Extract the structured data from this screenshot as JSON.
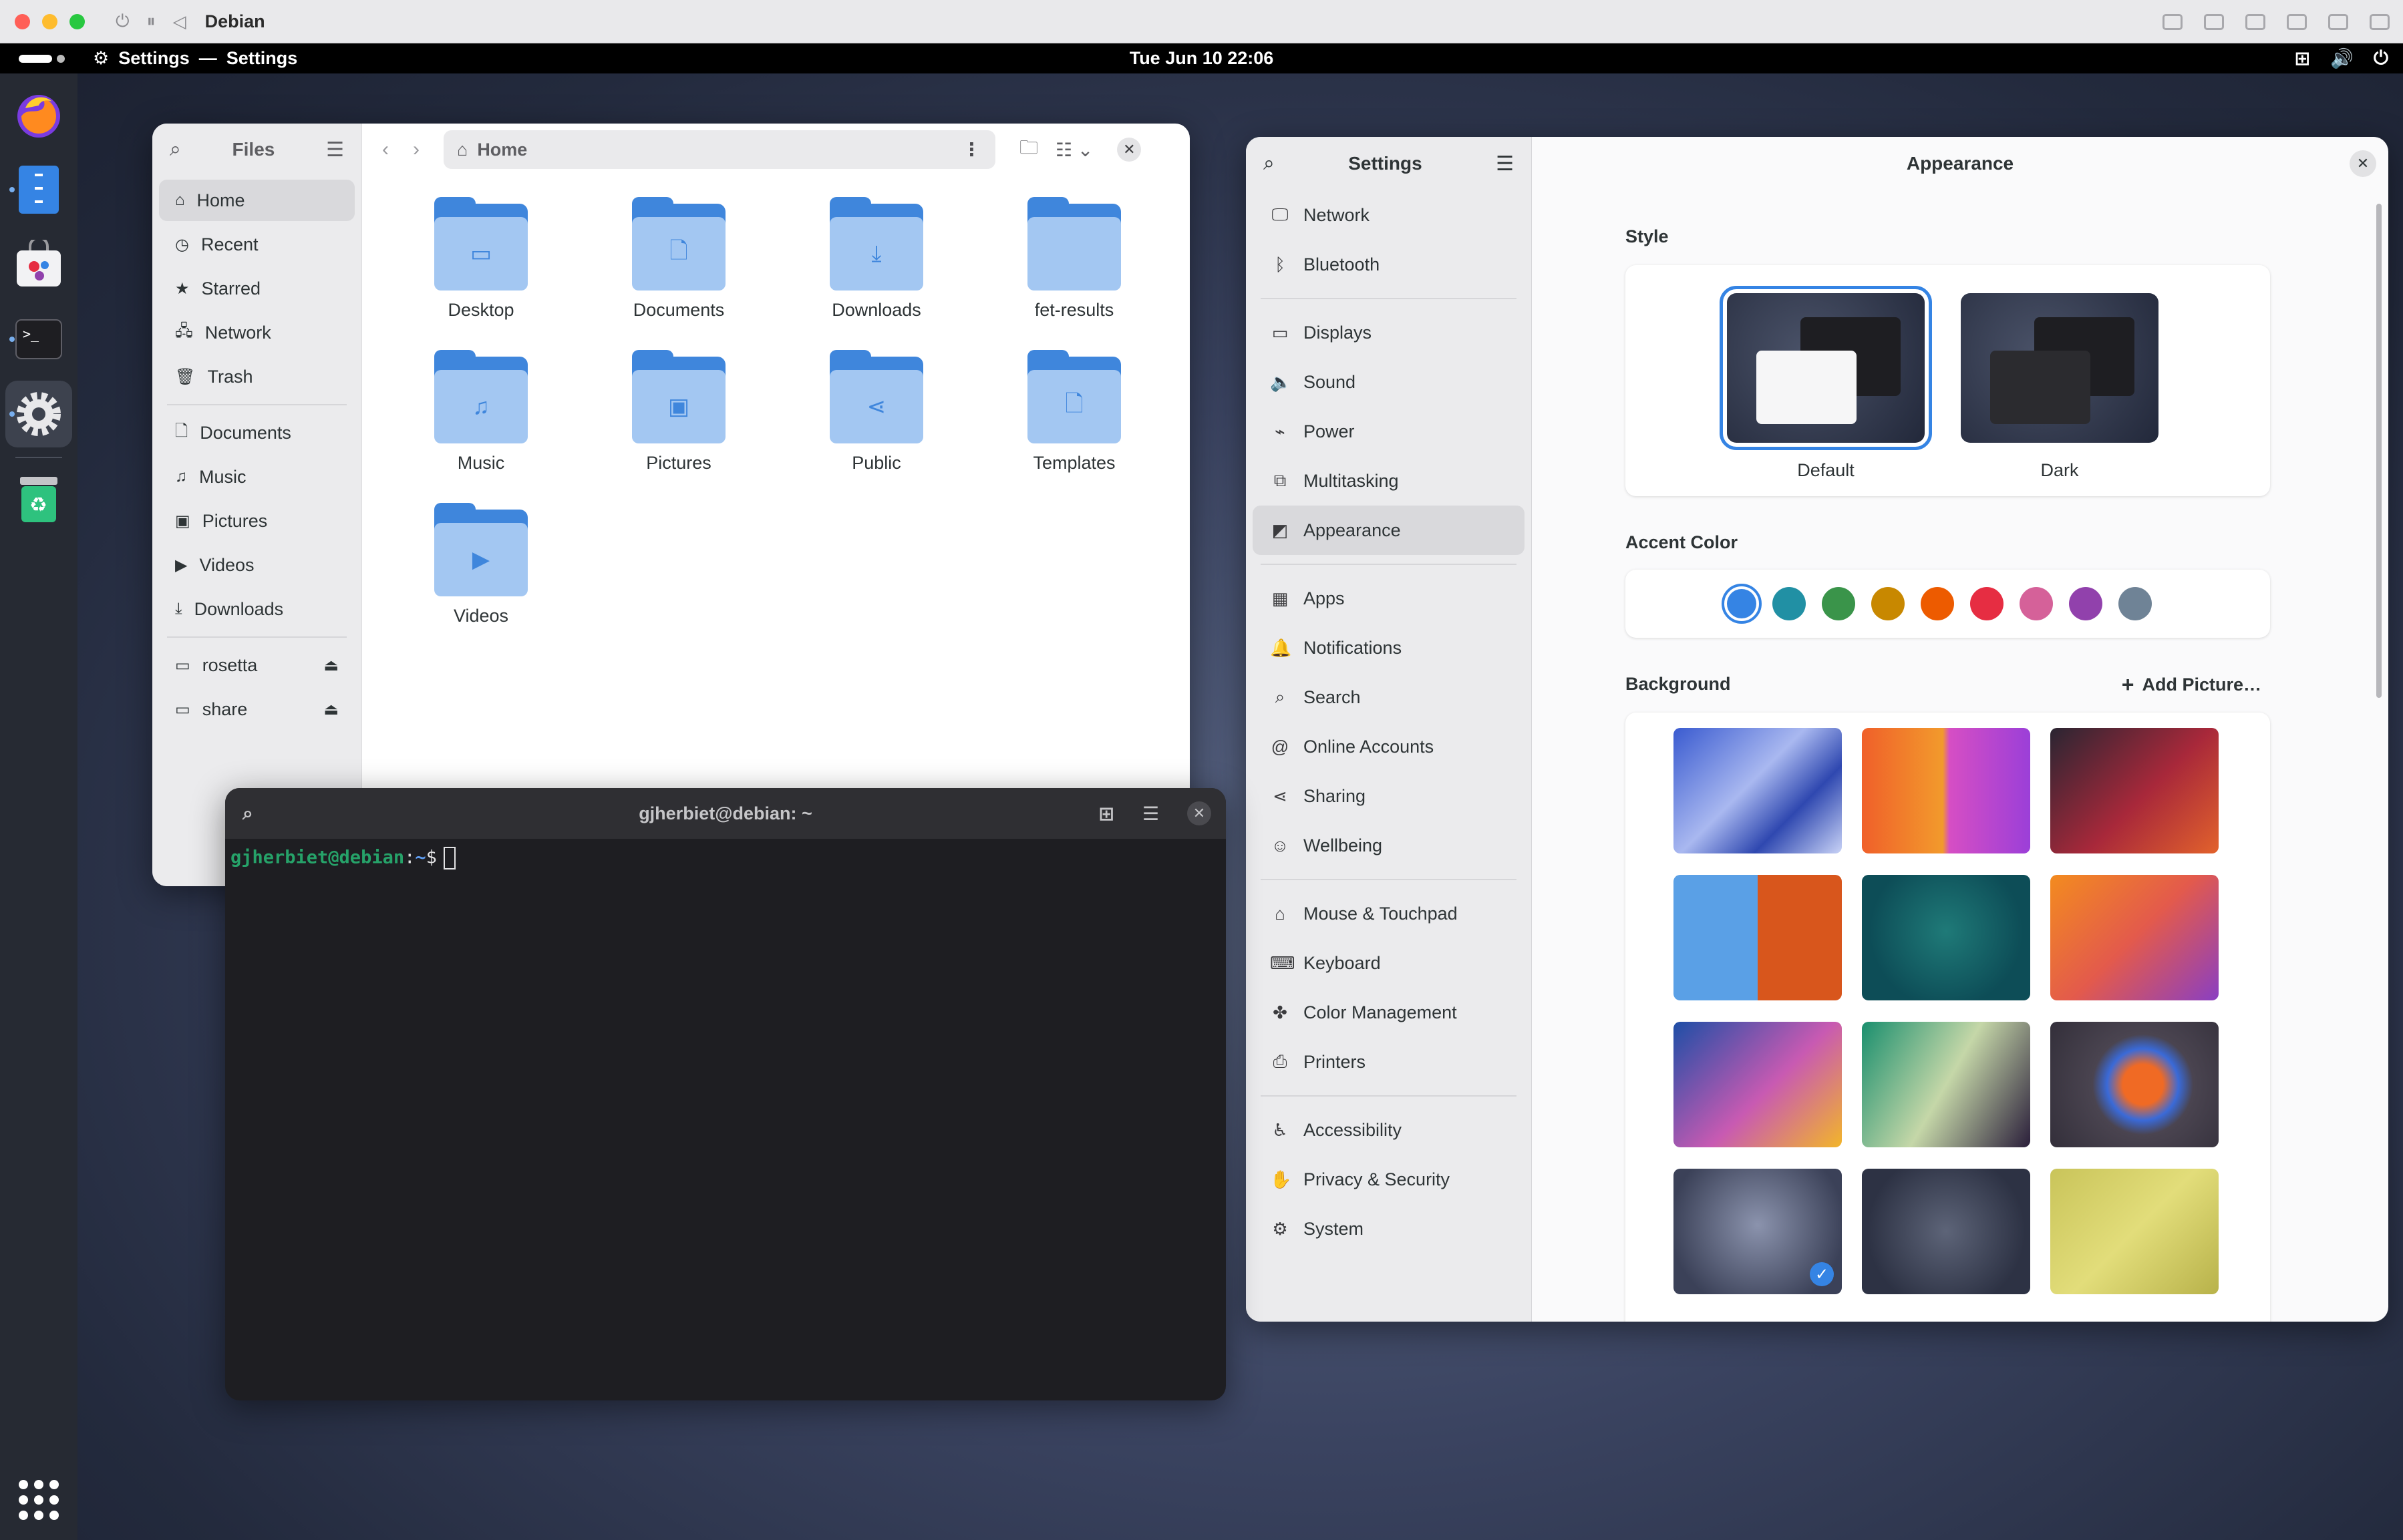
{
  "vm": {
    "title": "Debian",
    "traffic": [
      "#ff5f57",
      "#febc2e",
      "#28c840"
    ]
  },
  "topbar": {
    "app_name": "Settings",
    "separator": "—",
    "window_title": "Settings",
    "clock": "Tue Jun 10  22:06"
  },
  "dock": {
    "items": [
      "firefox",
      "files",
      "software",
      "terminal",
      "settings",
      "trash"
    ]
  },
  "files": {
    "title": "Files",
    "path": "Home",
    "sidebar": {
      "places": [
        {
          "label": "Home",
          "icon": "home-icon",
          "selected": true
        },
        {
          "label": "Recent",
          "icon": "clock-icon"
        },
        {
          "label": "Starred",
          "icon": "star-icon"
        },
        {
          "label": "Network",
          "icon": "network-icon"
        },
        {
          "label": "Trash",
          "icon": "trash-icon"
        }
      ],
      "bookmarks": [
        {
          "label": "Documents",
          "icon": "document-icon"
        },
        {
          "label": "Music",
          "icon": "music-icon"
        },
        {
          "label": "Pictures",
          "icon": "picture-icon"
        },
        {
          "label": "Videos",
          "icon": "video-icon"
        },
        {
          "label": "Downloads",
          "icon": "download-icon"
        }
      ],
      "devices": [
        {
          "label": "rosetta",
          "icon": "drive-icon"
        },
        {
          "label": "share",
          "icon": "drive-icon"
        }
      ]
    },
    "folders": [
      {
        "label": "Desktop",
        "glyph": "▭"
      },
      {
        "label": "Documents",
        "glyph": "🗋"
      },
      {
        "label": "Downloads",
        "glyph": "⤓"
      },
      {
        "label": "fet-results",
        "glyph": ""
      },
      {
        "label": "Music",
        "glyph": "♫"
      },
      {
        "label": "Pictures",
        "glyph": "▣"
      },
      {
        "label": "Public",
        "glyph": "⋖"
      },
      {
        "label": "Templates",
        "glyph": "🗋"
      },
      {
        "label": "Videos",
        "glyph": "▶"
      }
    ]
  },
  "terminal": {
    "title": "gjherbiet@debian: ~",
    "prompt_user": "gjherbiet@debian",
    "prompt_colon": ":",
    "prompt_path": "~",
    "prompt_symbol": "$"
  },
  "settings": {
    "sidebar_title": "Settings",
    "page_title": "Appearance",
    "groups": [
      [
        {
          "label": "Network",
          "icon": "monitor-icon",
          "glyph": "🖵"
        },
        {
          "label": "Bluetooth",
          "icon": "bluetooth-icon",
          "glyph": "ᛒ"
        }
      ],
      [
        {
          "label": "Displays",
          "icon": "display-icon",
          "glyph": "▭"
        },
        {
          "label": "Sound",
          "icon": "speaker-icon",
          "glyph": "🔈"
        },
        {
          "label": "Power",
          "icon": "battery-icon",
          "glyph": "⌁"
        },
        {
          "label": "Multitasking",
          "icon": "multitasking-icon",
          "glyph": "⧉"
        },
        {
          "label": "Appearance",
          "icon": "appearance-icon",
          "glyph": "◩",
          "selected": true
        }
      ],
      [
        {
          "label": "Apps",
          "icon": "apps-icon",
          "glyph": "▦"
        },
        {
          "label": "Notifications",
          "icon": "bell-icon",
          "glyph": "🔔"
        },
        {
          "label": "Search",
          "icon": "search-icon",
          "glyph": "⌕"
        },
        {
          "label": "Online Accounts",
          "icon": "at-icon",
          "glyph": "@"
        },
        {
          "label": "Sharing",
          "icon": "share-icon",
          "glyph": "⋖"
        },
        {
          "label": "Wellbeing",
          "icon": "wellbeing-icon",
          "glyph": "☺"
        }
      ],
      [
        {
          "label": "Mouse & Touchpad",
          "icon": "mouse-icon",
          "glyph": "⌂"
        },
        {
          "label": "Keyboard",
          "icon": "keyboard-icon",
          "glyph": "⌨"
        },
        {
          "label": "Color Management",
          "icon": "color-icon",
          "glyph": "✤"
        },
        {
          "label": "Printers",
          "icon": "printer-icon",
          "glyph": "⎙"
        }
      ],
      [
        {
          "label": "Accessibility",
          "icon": "accessibility-icon",
          "glyph": "♿"
        },
        {
          "label": "Privacy & Security",
          "icon": "hand-icon",
          "glyph": "✋"
        },
        {
          "label": "System",
          "icon": "gear-icon",
          "glyph": "⚙"
        }
      ]
    ],
    "style": {
      "heading": "Style",
      "options": [
        {
          "label": "Default",
          "selected": true,
          "front_color": "#f6f6f7"
        },
        {
          "label": "Dark",
          "selected": false,
          "front_color": "#2b2b2f"
        }
      ]
    },
    "accent": {
      "heading": "Accent Color",
      "colors": [
        "#3584e4",
        "#2190a4",
        "#3a944a",
        "#c88800",
        "#ed5b00",
        "#e62d42",
        "#d56199",
        "#9141ac",
        "#6f8396"
      ],
      "selected_index": 0
    },
    "background": {
      "heading": "Background",
      "add_label": "Add Picture…",
      "selected_index": 9,
      "tiles": [
        "linear-gradient(135deg,#3a5bd0,#a9b8f0 45%,#2f48b0 70%,#c8d2f6)",
        "linear-gradient(90deg,#f0602a,#f29a2c 48%,#d64ec4 52%,#9b3fd8)",
        "linear-gradient(135deg,#2a2532,#a8283a 55%,#e2622c)",
        "linear-gradient(90deg,#5aa0e6 50%,#d8561c 50%)",
        "radial-gradient(circle at 50% 45%,#1f7a78,#0d4d57 70%)",
        "linear-gradient(135deg,#f38b1f,#e35a4c 50%,#8a3fc2)",
        "linear-gradient(135deg,#1d4ea6,#c85ab2 55%,#f2b52a)",
        "linear-gradient(120deg,#1a8f6e,#c5d7a8 50%,#2a1e3a)",
        "radial-gradient(circle at 55% 50%,#f06a24 18%,#3a6ad8 32%,#4a4450 45%,#332f3a)",
        "radial-gradient(circle at 50% 45%,#8b93ad,#3b4158 80%)",
        "radial-gradient(circle at 50% 50%,#5d6478,#2d3244 75%)",
        "linear-gradient(135deg,#c9c45a,#e2dd7a 50%,#b8b24a)"
      ]
    }
  }
}
